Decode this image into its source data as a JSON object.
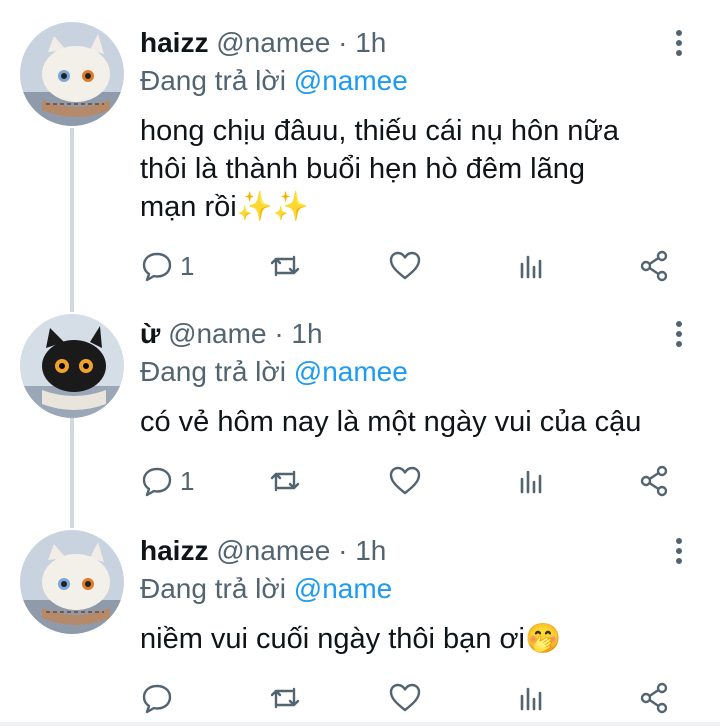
{
  "tweets": [
    {
      "name": "haizz",
      "handle": "@namee",
      "dot": "·",
      "time": "1h",
      "reply_prefix": "Đang trả lời ",
      "reply_to": "@namee",
      "text_line1": "hong chịu đâuu, thiếu cái nụ hôn nữa",
      "text_line2": "thôi là thành buổi hẹn hò đêm lãng",
      "text_line3": "mạn rồi",
      "emoji": "✨✨",
      "reply_count": "1"
    },
    {
      "name": "ừ",
      "handle": "@name",
      "dot": "·",
      "time": "1h",
      "reply_prefix": "Đang trả lời ",
      "reply_to": "@namee",
      "text": "có vẻ hôm nay là một ngày vui của cậu",
      "reply_count": "1"
    },
    {
      "name": "haizz",
      "handle": "@namee",
      "dot": "·",
      "time": "1h",
      "reply_prefix": "Đang trả lời ",
      "reply_to": "@name",
      "text": "niềm vui cuối ngày thôi bạn ơi",
      "emoji": "🤭",
      "reply_count": ""
    }
  ],
  "icons": {
    "reply": "reply-icon",
    "retweet": "retweet-icon",
    "like": "heart-icon",
    "views": "analytics-icon",
    "share": "share-icon",
    "more": "more-vertical-icon"
  },
  "colors": {
    "mention": "#1d9bf0",
    "secondary_text": "#536471",
    "thread_line": "#cfd9de"
  }
}
